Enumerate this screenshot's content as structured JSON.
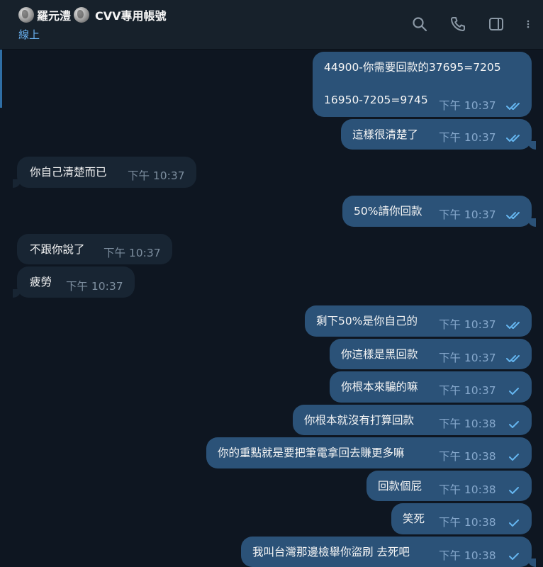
{
  "header": {
    "contact_name": "羅元澧",
    "account_label": "CVV專用帳號",
    "status": "線上",
    "icons": [
      "globe-avatar-icon",
      "search-icon",
      "phone-icon",
      "sidebar-icon",
      "more-vertical-icon"
    ]
  },
  "colors": {
    "background": "#0e1621",
    "header": "#17212b",
    "outgoing_bubble": "#2b5278",
    "incoming_bubble": "#182533",
    "status_text": "#6ab3f3",
    "tick": "#64b5ef"
  },
  "messages": [
    {
      "dir": "out",
      "text": "44900-你需要回款的37695=7205",
      "text2": "16950-7205=9745",
      "time": "下午 10:37",
      "read": true
    },
    {
      "dir": "out",
      "text": "這樣很清楚了",
      "time": "下午 10:37",
      "read": true
    },
    {
      "dir": "in",
      "text": "你自己清楚而已",
      "time": "下午 10:37"
    },
    {
      "dir": "out",
      "text": "50%請你回款",
      "time": "下午 10:37",
      "read": true
    },
    {
      "dir": "in",
      "text": "不跟你說了",
      "time": "下午 10:37"
    },
    {
      "dir": "in",
      "text": "疲勞",
      "time": "下午 10:37"
    },
    {
      "dir": "out",
      "text": "剩下50%是你自己的",
      "time": "下午 10:37",
      "read": true
    },
    {
      "dir": "out",
      "text": "你這樣是黑回款",
      "time": "下午 10:37",
      "read": true
    },
    {
      "dir": "out",
      "text": "你根本來騙的嘛",
      "time": "下午 10:37",
      "read": false
    },
    {
      "dir": "out",
      "text": "你根本就沒有打算回款",
      "time": "下午 10:38",
      "read": false
    },
    {
      "dir": "out",
      "text": "你的重點就是要把筆電拿回去賺更多嘛",
      "time": "下午 10:38",
      "read": false
    },
    {
      "dir": "out",
      "text": "回款個屁",
      "time": "下午 10:38",
      "read": false
    },
    {
      "dir": "out",
      "text": "笑死",
      "time": "下午 10:38",
      "read": false
    },
    {
      "dir": "out",
      "text": "我叫台灣那邊檢舉你盜刷 去死吧",
      "time": "下午 10:38",
      "read": false
    }
  ]
}
